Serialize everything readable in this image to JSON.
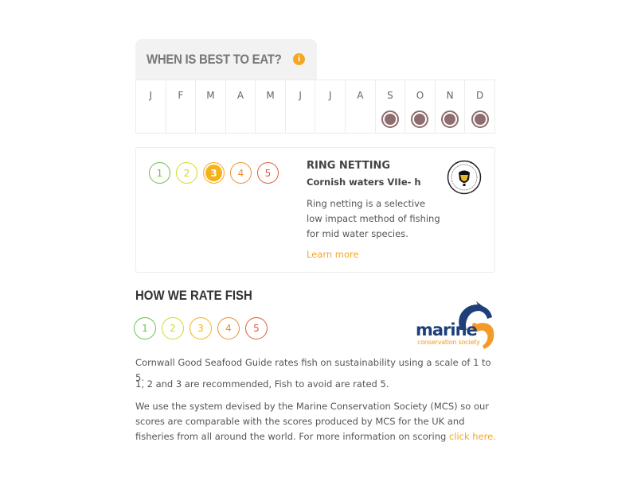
{
  "best_to_eat": {
    "title": "WHEN IS BEST TO EAT?",
    "info_icon": "info-icon",
    "months": [
      {
        "label": "J",
        "in_season": false
      },
      {
        "label": "F",
        "in_season": false
      },
      {
        "label": "M",
        "in_season": false
      },
      {
        "label": "A",
        "in_season": false
      },
      {
        "label": "M",
        "in_season": false
      },
      {
        "label": "J",
        "in_season": false
      },
      {
        "label": "J",
        "in_season": false
      },
      {
        "label": "A",
        "in_season": false
      },
      {
        "label": "S",
        "in_season": true
      },
      {
        "label": "O",
        "in_season": true
      },
      {
        "label": "N",
        "in_season": true
      },
      {
        "label": "D",
        "in_season": true
      }
    ],
    "season_color": "#8e6d6e"
  },
  "method_card": {
    "ratings": [
      {
        "value": "1",
        "color": "#6cbf4b",
        "active": false
      },
      {
        "value": "2",
        "color": "#d4d928",
        "active": false
      },
      {
        "value": "3",
        "color": "#f6b21b",
        "active": true
      },
      {
        "value": "4",
        "color": "#e8912e",
        "active": false
      },
      {
        "value": "5",
        "color": "#e05a3a",
        "active": false
      }
    ],
    "selected_rating": 3,
    "title": "RING NETTING",
    "area": "Cornish waters VIIe- h",
    "description": "Ring netting is a selective low impact method of fishing for mid water species.",
    "learn_more": "Learn more",
    "badge": "recommended-badge-icon",
    "badge_text": "RECOMMENDED"
  },
  "how_we_rate": {
    "title": "HOW WE RATE FISH",
    "ratings": [
      {
        "value": "1",
        "color": "#6cbf4b"
      },
      {
        "value": "2",
        "color": "#d4d928"
      },
      {
        "value": "3",
        "color": "#f6b21b"
      },
      {
        "value": "4",
        "color": "#e8912e"
      },
      {
        "value": "5",
        "color": "#e05a3a"
      }
    ],
    "logo": {
      "word": "marine",
      "subtitle": "conservation society"
    },
    "paragraph1": "Cornwall Good Seafood Guide rates fish on sustainability using a scale of 1 to 5.",
    "paragraph2": "1, 2 and 3 are recommended, Fish to avoid are rated 5.",
    "paragraph3": "We use the system devised by the Marine Conservation Society (MCS) so our scores are comparable with the scores produced by MCS for the UK and fisheries from all around the world. For more information on scoring ",
    "link_text": "click here."
  },
  "colors": {
    "accent": "#f6a623",
    "border": "#ececec",
    "tab_bg": "#f2f2f2"
  }
}
